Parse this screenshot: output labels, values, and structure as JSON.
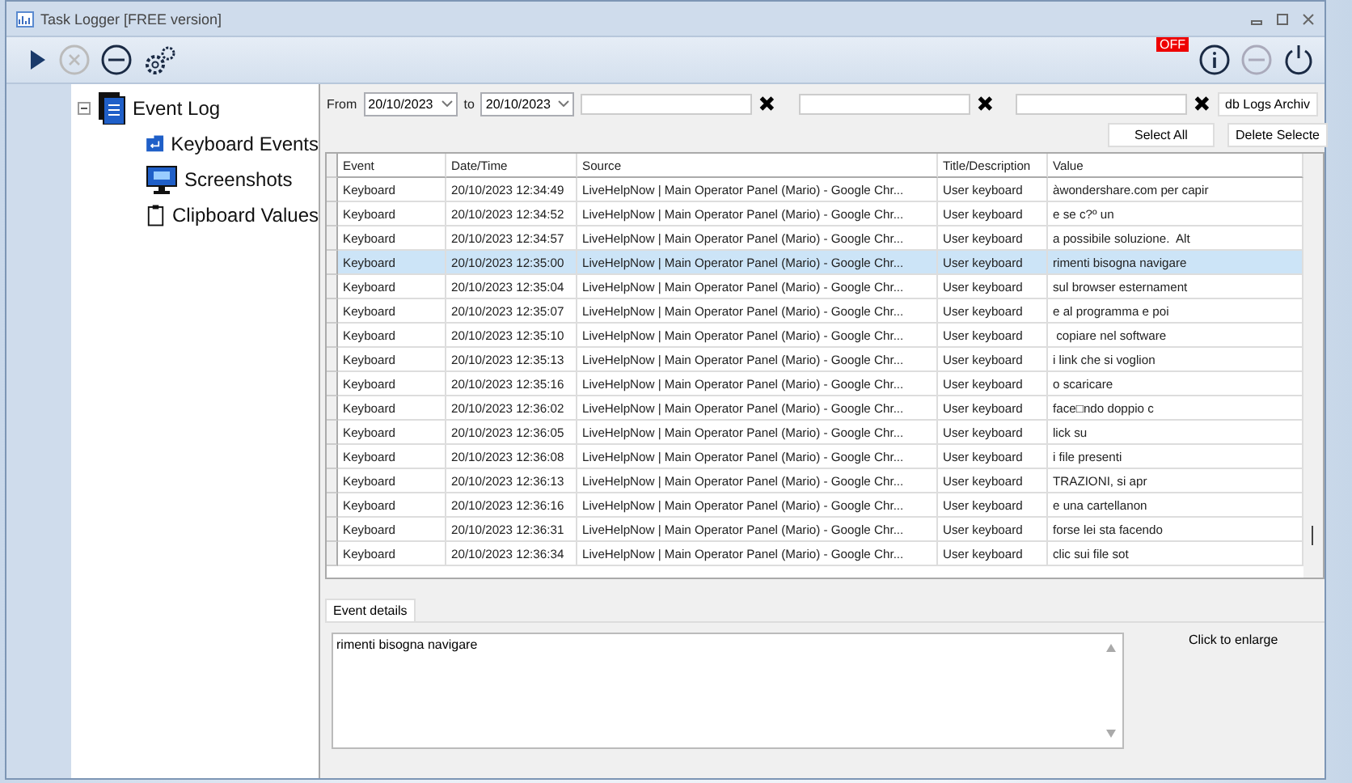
{
  "window": {
    "title": "Task Logger [FREE version]"
  },
  "toolbar": {
    "status_badge": "OFF"
  },
  "tree": {
    "label": "Event Log",
    "expanded": true,
    "children": [
      {
        "label": "Keyboard Events",
        "kind": "keyboard"
      },
      {
        "label": "Screenshots",
        "kind": "monitor"
      },
      {
        "label": "Clipboard Values",
        "kind": "clipboard"
      }
    ]
  },
  "filters": {
    "from_label": "From",
    "from": "20/10/2023",
    "to_label": "to",
    "to": "20/10/2023",
    "archive_button": "db Logs Archiv",
    "select_all": "Select All",
    "delete_selected": "Delete Selecte"
  },
  "table": {
    "columns": [
      "Event",
      "Date/Time",
      "Source",
      "Title/Description",
      "Value"
    ],
    "rows": [
      {
        "cells": [
          "Keyboard",
          "20/10/2023 12:34:49",
          "LiveHelpNow | Main Operator Panel (Mario) - Google Chr...",
          "User keyboard",
          "àwondershare.com per capir"
        ],
        "selected": false
      },
      {
        "cells": [
          "Keyboard",
          "20/10/2023 12:34:52",
          "LiveHelpNow | Main Operator Panel (Mario) - Google Chr...",
          "User keyboard",
          "e se c?º un"
        ],
        "selected": false
      },
      {
        "cells": [
          "Keyboard",
          "20/10/2023 12:34:57",
          "LiveHelpNow | Main Operator Panel (Mario) - Google Chr...",
          "User keyboard",
          "a possibile soluzione.  Alt"
        ],
        "selected": false
      },
      {
        "cells": [
          "Keyboard",
          "20/10/2023 12:35:00",
          "LiveHelpNow | Main Operator Panel (Mario) - Google Chr...",
          "User keyboard",
          "rimenti bisogna navigare"
        ],
        "selected": true
      },
      {
        "cells": [
          "Keyboard",
          "20/10/2023 12:35:04",
          "LiveHelpNow | Main Operator Panel (Mario) - Google Chr...",
          "User keyboard",
          "sul browser esternament"
        ],
        "selected": false
      },
      {
        "cells": [
          "Keyboard",
          "20/10/2023 12:35:07",
          "LiveHelpNow | Main Operator Panel (Mario) - Google Chr...",
          "User keyboard",
          "e al programma e poi"
        ],
        "selected": false
      },
      {
        "cells": [
          "Keyboard",
          "20/10/2023 12:35:10",
          "LiveHelpNow | Main Operator Panel (Mario) - Google Chr...",
          "User keyboard",
          " copiare nel software"
        ],
        "selected": false
      },
      {
        "cells": [
          "Keyboard",
          "20/10/2023 12:35:13",
          "LiveHelpNow | Main Operator Panel (Mario) - Google Chr...",
          "User keyboard",
          "i link che si voglion"
        ],
        "selected": false
      },
      {
        "cells": [
          "Keyboard",
          "20/10/2023 12:35:16",
          "LiveHelpNow | Main Operator Panel (Mario) - Google Chr...",
          "User keyboard",
          "o scaricare"
        ],
        "selected": false
      },
      {
        "cells": [
          "Keyboard",
          "20/10/2023 12:36:02",
          "LiveHelpNow | Main Operator Panel (Mario) - Google Chr...",
          "User keyboard",
          "face□ndo doppio c"
        ],
        "selected": false
      },
      {
        "cells": [
          "Keyboard",
          "20/10/2023 12:36:05",
          "LiveHelpNow | Main Operator Panel (Mario) - Google Chr...",
          "User keyboard",
          "lick su"
        ],
        "selected": false
      },
      {
        "cells": [
          "Keyboard",
          "20/10/2023 12:36:08",
          "LiveHelpNow | Main Operator Panel (Mario) - Google Chr...",
          "User keyboard",
          "i file presenti"
        ],
        "selected": false
      },
      {
        "cells": [
          "Keyboard",
          "20/10/2023 12:36:13",
          "LiveHelpNow | Main Operator Panel (Mario) - Google Chr...",
          "User keyboard",
          "TRAZIONI, si apr"
        ],
        "selected": false
      },
      {
        "cells": [
          "Keyboard",
          "20/10/2023 12:36:16",
          "LiveHelpNow | Main Operator Panel (Mario) - Google Chr...",
          "User keyboard",
          "e una cartellanon"
        ],
        "selected": false
      },
      {
        "cells": [
          "Keyboard",
          "20/10/2023 12:36:31",
          "LiveHelpNow | Main Operator Panel (Mario) - Google Chr...",
          "User keyboard",
          "forse lei sta facendo"
        ],
        "selected": false
      },
      {
        "cells": [
          "Keyboard",
          "20/10/2023 12:36:34",
          "LiveHelpNow | Main Operator Panel (Mario) - Google Chr...",
          "User keyboard",
          "clic sui file sot"
        ],
        "selected": false
      }
    ]
  },
  "details": {
    "tab": "Event details",
    "text": "rimenti bisogna navigare",
    "enlarge_label": "Click to enlarge"
  }
}
